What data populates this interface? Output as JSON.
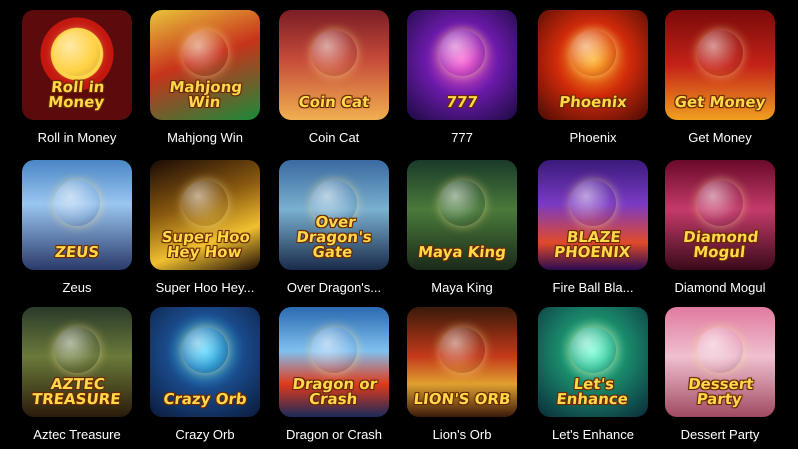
{
  "games": [
    {
      "label": "Roll in Money",
      "logo_text": "Roll in Money",
      "icon": "roll-in-money-thumbnail"
    },
    {
      "label": "Mahjong Win",
      "logo_text": "Mahjong Win",
      "icon": "mahjong-win-thumbnail"
    },
    {
      "label": "Coin Cat",
      "logo_text": "Coin Cat",
      "icon": "coin-cat-thumbnail"
    },
    {
      "label": "777",
      "logo_text": "777",
      "icon": "777-thumbnail"
    },
    {
      "label": "Phoenix",
      "logo_text": "Phoenix",
      "icon": "phoenix-thumbnail"
    },
    {
      "label": "Get Money",
      "logo_text": "Get Money",
      "icon": "get-money-thumbnail"
    },
    {
      "label": "Zeus",
      "logo_text": "ZEUS",
      "icon": "zeus-thumbnail"
    },
    {
      "label": "Super Hoo Hey...",
      "logo_text": "Super Hoo Hey How",
      "icon": "super-hoo-hey-how-thumbnail"
    },
    {
      "label": "Over Dragon's...",
      "logo_text": "Over Dragon's Gate",
      "icon": "over-dragons-gate-thumbnail"
    },
    {
      "label": "Maya King",
      "logo_text": "Maya King",
      "icon": "maya-king-thumbnail"
    },
    {
      "label": "Fire Ball Bla...",
      "logo_text": "BLAZE PHOENIX",
      "icon": "fire-ball-blaze-phoenix-thumbnail"
    },
    {
      "label": "Diamond Mogul",
      "logo_text": "Diamond Mogul",
      "icon": "diamond-mogul-thumbnail"
    },
    {
      "label": "Aztec Treasure",
      "logo_text": "AZTEC TREASURE",
      "icon": "aztec-treasure-thumbnail"
    },
    {
      "label": "Crazy Orb",
      "logo_text": "Crazy Orb",
      "icon": "crazy-orb-thumbnail"
    },
    {
      "label": "Dragon or Crash",
      "logo_text": "Dragon or Crash",
      "icon": "dragon-or-crash-thumbnail"
    },
    {
      "label": "Lion's Orb",
      "logo_text": "LION'S ORB",
      "icon": "lions-orb-thumbnail"
    },
    {
      "label": "Let's Enhance",
      "logo_text": "Let's Enhance",
      "icon": "lets-enhance-thumbnail"
    },
    {
      "label": "Dessert Party",
      "logo_text": "Dessert Party",
      "icon": "dessert-party-thumbnail"
    }
  ],
  "colors": {
    "background": "#000000",
    "label": "#ffffff",
    "logo": "#ffd84a"
  }
}
